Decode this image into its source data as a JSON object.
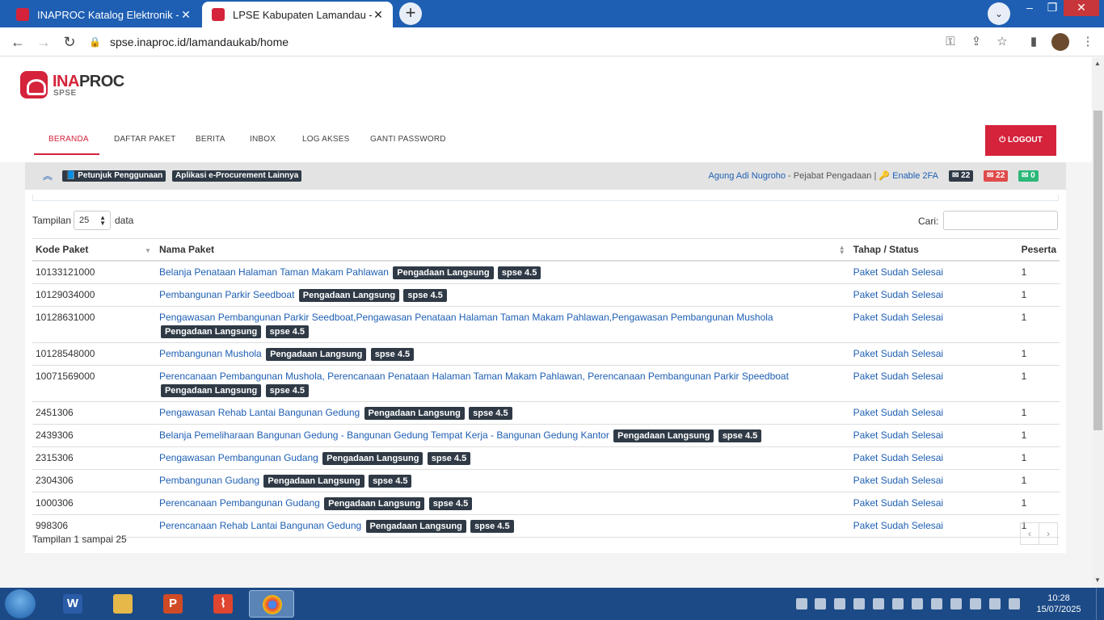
{
  "browser": {
    "tabs": [
      {
        "title": "INAPROC Katalog Elektronik - Po",
        "close": "✕"
      },
      {
        "title": "LPSE Kabupaten Lamandau - Hor",
        "close": "✕"
      }
    ],
    "new_tab": "+",
    "tab_search": "⌄",
    "url": "spse.inaproc.id/lamandaukab/home"
  },
  "site": {
    "logo_ina": "INA",
    "logo_proc": "PROC",
    "logo_sub": "SPSE",
    "menu": [
      "BERANDA",
      "DAFTAR PAKET",
      "BERITA",
      "INBOX",
      "LOG AKSES",
      "GANTI PASSWORD"
    ],
    "logout": "⏻ LOGOUT"
  },
  "infobar": {
    "guide": "📘 Petunjuk Penggunaan",
    "other_apps": "Aplikasi e-Procurement Lainnya",
    "user_name": "Agung Adi Nugroho",
    "user_role": " - Pejabat Pengadaan | ",
    "enable_2fa": "🔑 Enable 2FA",
    "badge_mail": "✉ 22",
    "badge_mail_unread": "✉ 22",
    "badge_open": "✉ 0",
    "colors": {
      "dark": "#2f3a46",
      "red": "#e04b4b",
      "green": "#2db87a"
    }
  },
  "table_controls": {
    "length_label": "Tampilan",
    "length_value": "25",
    "length_after": "data",
    "search_label": "Cari:",
    "search_value": ""
  },
  "table": {
    "headers": [
      "Kode Paket",
      "Nama Paket",
      "Tahap / Status",
      "Peserta"
    ],
    "rows": [
      {
        "kode": "10133121000",
        "nama": "Belanja Penataan Halaman Taman Makam Pahlawan",
        "metode": "Pengadaan Langsung",
        "versi": "spse 4.5",
        "status": "Paket Sudah Selesai",
        "peserta": "1"
      },
      {
        "kode": "10129034000",
        "nama": "Pembangunan Parkir Seedboat",
        "metode": "Pengadaan Langsung",
        "versi": "spse 4.5",
        "status": "Paket Sudah Selesai",
        "peserta": "1"
      },
      {
        "kode": "10128631000",
        "nama": "Pengawasan Pembangunan Parkir Seedboat,Pengawasan Penataan Halaman Taman Makam Pahlawan,Pengawasan Pembangunan Mushola",
        "metode": "Pengadaan Langsung",
        "versi": "spse 4.5",
        "status": "Paket Sudah Selesai",
        "peserta": "1"
      },
      {
        "kode": "10128548000",
        "nama": "Pembangunan Mushola",
        "metode": "Pengadaan Langsung",
        "versi": "spse 4.5",
        "status": "Paket Sudah Selesai",
        "peserta": "1"
      },
      {
        "kode": "10071569000",
        "nama": "Perencanaan Pembangunan Mushola, Perencanaan Penataan Halaman Taman Makam Pahlawan, Perencanaan Pembangunan Parkir Speedboat",
        "metode": "Pengadaan Langsung",
        "versi": "spse 4.5",
        "status": "Paket Sudah Selesai",
        "peserta": "1"
      },
      {
        "kode": "2451306",
        "nama": "Pengawasan Rehab Lantai Bangunan Gedung",
        "metode": "Pengadaan Langsung",
        "versi": "spse 4.5",
        "status": "Paket Sudah Selesai",
        "peserta": "1"
      },
      {
        "kode": "2439306",
        "nama": "Belanja Pemeliharaan Bangunan Gedung - Bangunan Gedung Tempat Kerja - Bangunan Gedung Kantor",
        "metode": "Pengadaan Langsung",
        "versi": "spse 4.5",
        "status": "Paket Sudah Selesai",
        "peserta": "1"
      },
      {
        "kode": "2315306",
        "nama": "Pengawasan Pembangunan Gudang",
        "metode": "Pengadaan Langsung",
        "versi": "spse 4.5",
        "status": "Paket Sudah Selesai",
        "peserta": "1"
      },
      {
        "kode": "2304306",
        "nama": "Pembangunan Gudang",
        "metode": "Pengadaan Langsung",
        "versi": "spse 4.5",
        "status": "Paket Sudah Selesai",
        "peserta": "1"
      },
      {
        "kode": "1000306",
        "nama": "Perencanaan Pembangunan Gudang",
        "metode": "Pengadaan Langsung",
        "versi": "spse 4.5",
        "status": "Paket Sudah Selesai",
        "peserta": "1"
      },
      {
        "kode": "998306",
        "nama": "Perencanaan Rehab Lantai Bangunan Gedung",
        "metode": "Pengadaan Langsung",
        "versi": "spse 4.5",
        "status": "Paket Sudah Selesai",
        "peserta": "1"
      }
    ],
    "info": "Tampilan 1 sampai 25",
    "prev": "‹",
    "next": "›"
  },
  "taskbar": {
    "apps": [
      "word-icon",
      "explorer-icon",
      "powerpoint-icon",
      "pdf-icon",
      "chrome-icon"
    ],
    "time": "10:28",
    "date": "15/07/2025"
  }
}
